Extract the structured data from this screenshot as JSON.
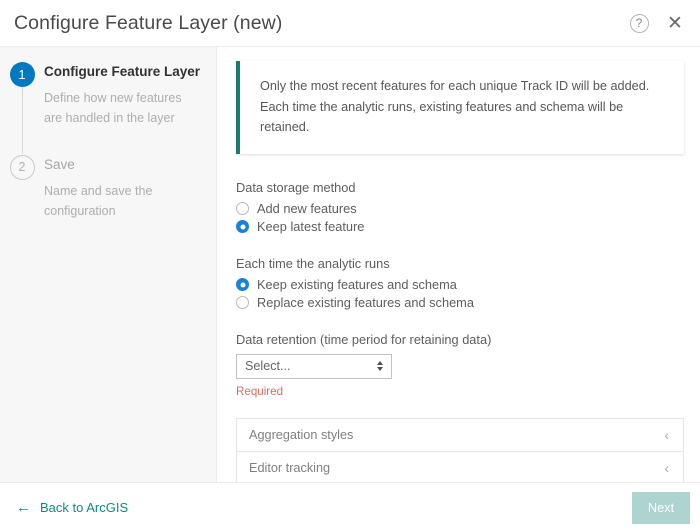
{
  "header": {
    "title": "Configure Feature Layer (new)",
    "help_icon": "help-circle-icon",
    "help_glyph": "?",
    "close_icon": "close-icon",
    "close_glyph": "✕"
  },
  "sidebar": {
    "steps": [
      {
        "number": "1",
        "title": "Configure Feature Layer",
        "description": "Define how new features are handled in the layer",
        "state": "active"
      },
      {
        "number": "2",
        "title": "Save",
        "description": "Name and save the configuration",
        "state": "inactive"
      }
    ]
  },
  "main": {
    "banner": {
      "text": "Only the most recent features for each unique Track ID will be added. Each time the analytic runs, existing features and schema will be retained.",
      "accent_color": "#1a7a6e"
    },
    "data_storage_method": {
      "label": "Data storage method",
      "options": [
        {
          "label": "Add new features",
          "selected": false
        },
        {
          "label": "Keep latest feature",
          "selected": true
        }
      ]
    },
    "analytic_runs": {
      "label": "Each time the analytic runs",
      "options": [
        {
          "label": "Keep existing features and schema",
          "selected": true
        },
        {
          "label": "Replace existing features and schema",
          "selected": false
        }
      ]
    },
    "data_retention": {
      "label": "Data retention (time period for retaining data)",
      "value": "Select...",
      "validation": "Required",
      "validation_color": "#e06a5a"
    },
    "accordion": [
      {
        "label": "Aggregation styles",
        "chevron": "‹"
      },
      {
        "label": "Editor tracking",
        "chevron": "‹"
      }
    ]
  },
  "footer": {
    "back_label": "Back to ArcGIS",
    "back_arrow": "←",
    "next_label": "Next",
    "next_disabled": true,
    "link_color": "#0f8c82",
    "next_color": "#add4ce"
  }
}
